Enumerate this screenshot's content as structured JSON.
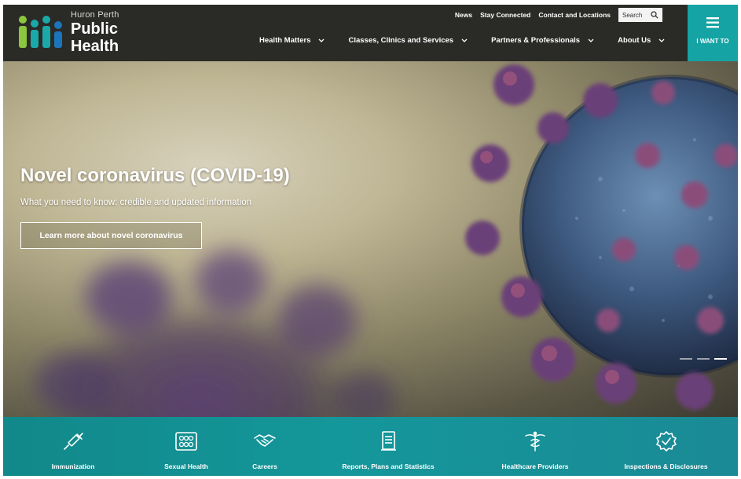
{
  "brand": {
    "small": "Huron Perth",
    "line1": "Public",
    "line2": "Health"
  },
  "utility_nav": [
    "News",
    "Stay Connected",
    "Contact and Locations"
  ],
  "search": {
    "label": "Search",
    "icon": "search-icon"
  },
  "main_nav": [
    {
      "label": "Health Matters"
    },
    {
      "label": "Classes, Clinics and Services"
    },
    {
      "label": "Partners & Professionals"
    },
    {
      "label": "About Us"
    }
  ],
  "i_want_to": {
    "label": "I WANT TO",
    "icon": "hamburger-icon"
  },
  "hero": {
    "title": "Novel coronavirus (COVID-19)",
    "subtitle": "What you need to know: credible and updated information",
    "button": "Learn more about novel coronavirus",
    "slides": 3,
    "active_slide": 3
  },
  "quick_links": [
    {
      "label": "Immunization",
      "icon": "syringe-icon"
    },
    {
      "label": "Sexual Health",
      "icon": "pill-pack-icon"
    },
    {
      "label": "Careers",
      "icon": "handshake-icon"
    },
    {
      "label": "Reports, Plans and Statistics",
      "icon": "document-icon"
    },
    {
      "label": "Healthcare Providers",
      "icon": "caduceus-icon"
    },
    {
      "label": "Inspections & Disclosures",
      "icon": "badge-check-icon"
    }
  ],
  "colors": {
    "header_bg": "#2a2a27",
    "accent_teal": "#15a3a3",
    "quicklinks_bg": "#14979a",
    "logo_green": "#8cc63f",
    "logo_teal": "#1ba8a8",
    "logo_blue": "#1b75bb"
  }
}
